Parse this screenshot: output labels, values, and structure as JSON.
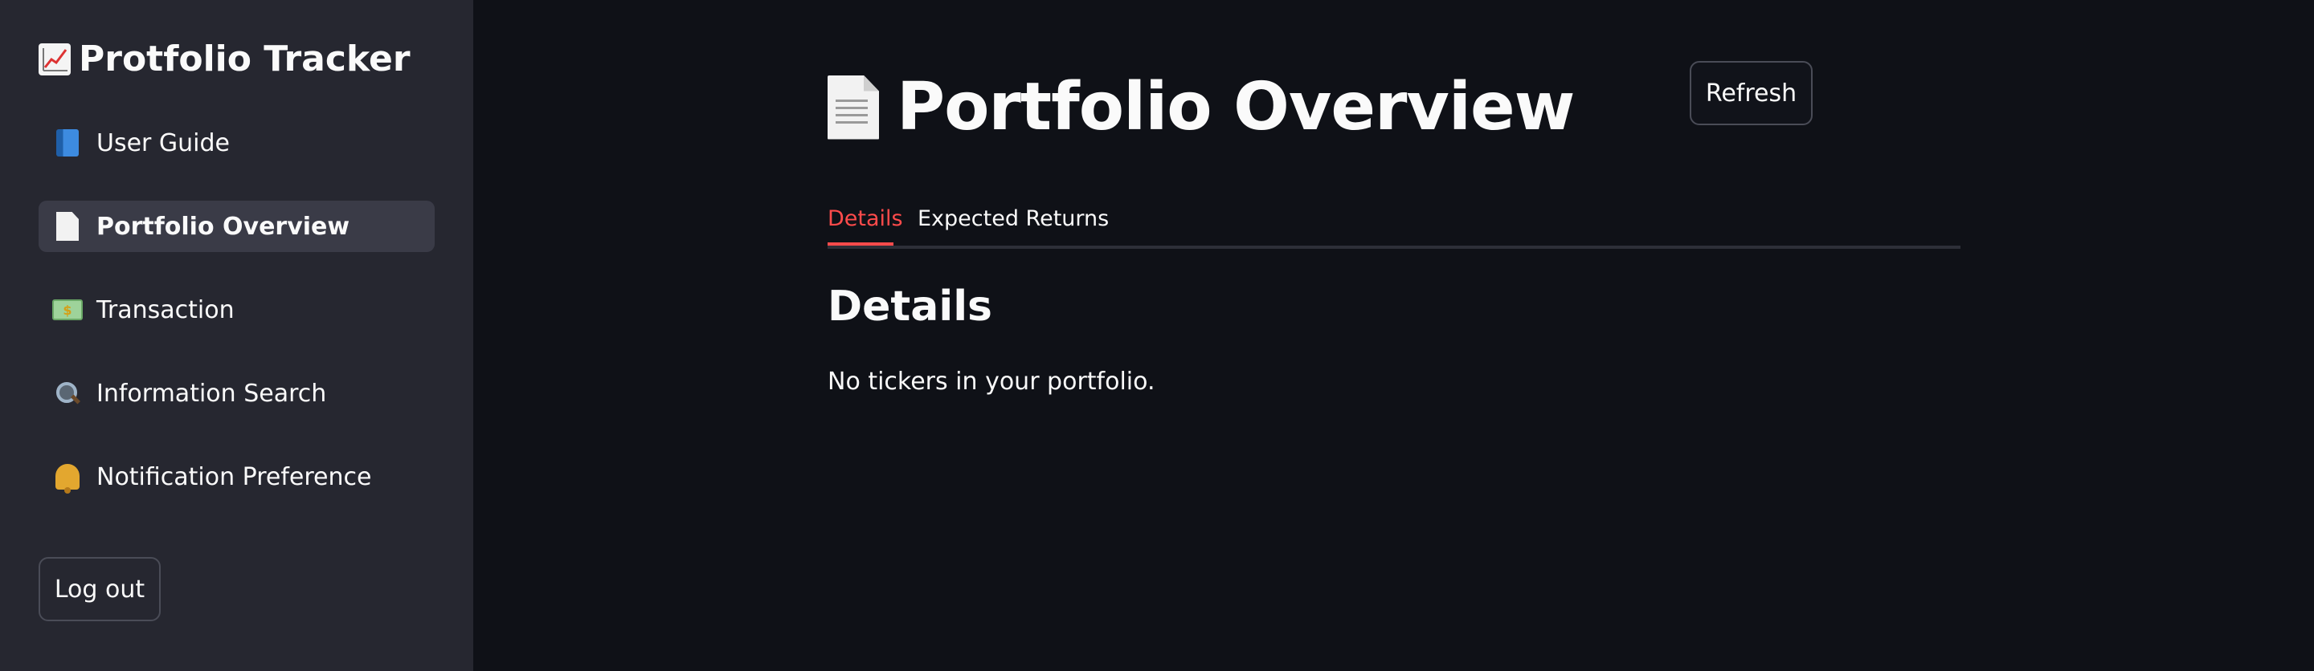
{
  "sidebar": {
    "title": "Protfolio Tracker",
    "title_icon": "chart-increasing-icon",
    "items": [
      {
        "label": "User Guide",
        "icon": "book-icon",
        "active": false
      },
      {
        "label": "Portfolio Overview",
        "icon": "page-icon",
        "active": true
      },
      {
        "label": "Transaction",
        "icon": "money-icon",
        "active": false
      },
      {
        "label": "Information Search",
        "icon": "magnifier-icon",
        "active": false
      },
      {
        "label": "Notification Preference",
        "icon": "bell-icon",
        "active": false
      }
    ],
    "logout_label": "Log out"
  },
  "main": {
    "page_title": "Portfolio Overview",
    "page_icon": "page-icon",
    "refresh_label": "Refresh",
    "tabs": [
      {
        "label": "Details",
        "active": true
      },
      {
        "label": "Expected Returns",
        "active": false
      }
    ],
    "section_title": "Details",
    "empty_message": "No tickers in your portfolio."
  },
  "colors": {
    "background": "#0f1117",
    "sidebar_background": "#262730",
    "accent": "#ff4b4b",
    "text": "#fafafa"
  }
}
